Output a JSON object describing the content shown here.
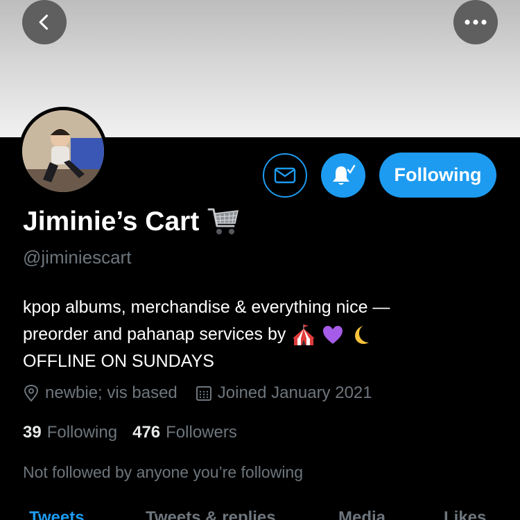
{
  "profile": {
    "display_name": "Jiminie’s Cart",
    "handle": "@jiminiescart",
    "bio_line1": "kpop albums, merchandise & everything nice —",
    "bio_line2": "preorder and pahanap services by",
    "bio_line3": "OFFLINE ON SUNDAYS",
    "location": "newbie; vis based",
    "joined": "Joined January 2021",
    "following_count": "39",
    "following_label": "Following",
    "followers_count": "476",
    "followers_label": "Followers",
    "mutuals_note": "Not followed by anyone you’re following"
  },
  "actions": {
    "follow_state_label": "Following"
  },
  "tabs": [
    {
      "label": "Tweets"
    },
    {
      "label": "Tweets & replies"
    },
    {
      "label": "Media"
    },
    {
      "label": "Likes"
    }
  ],
  "colors": {
    "accent": "#1d9bf0",
    "background": "#000000",
    "secondary_text": "#6e767d"
  },
  "icons": [
    "back-arrow-icon",
    "more-icon",
    "envelope-icon",
    "bell-icon",
    "shopping-cart-emoji",
    "circus-tent-emoji",
    "purple-heart-emoji",
    "crescent-moon-emoji",
    "location-icon",
    "calendar-icon"
  ]
}
